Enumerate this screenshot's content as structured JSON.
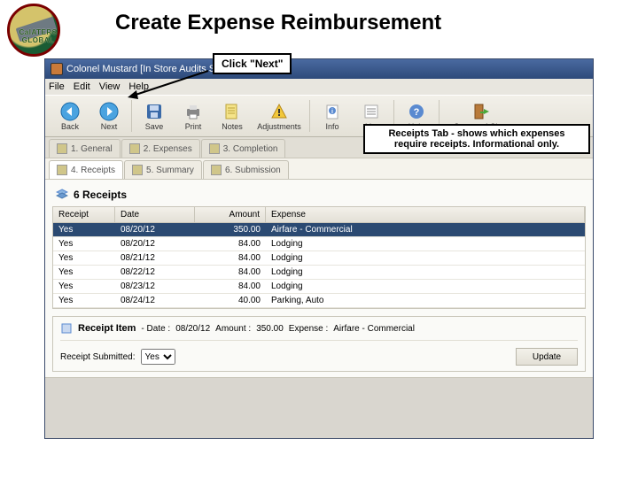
{
  "slide_title": "Create Expense Reimbursement",
  "logo_text": "CalATERS GLOBAL",
  "callouts": {
    "next": "Click  \"Next\"",
    "receipts_l1": "Receipts Tab - shows which expenses",
    "receipts_l2": "require receipts. Informational only."
  },
  "window": {
    "title": "Colonel Mustard [In Store Audits Sept. 2012]",
    "menu": [
      "File",
      "Edit",
      "View",
      "Help"
    ]
  },
  "toolbar": {
    "back": "Back",
    "next": "Next",
    "save": "Save",
    "print": "Print",
    "notes": "Notes",
    "adjustments": "Adjustments",
    "info": "Info",
    "list": "List",
    "help": "Help",
    "save_close": "Save and Close"
  },
  "tabs": {
    "t1": "1. General",
    "t2": "2. Expenses",
    "t3": "3. Completion"
  },
  "subtabs": {
    "s1": "4. Receipts",
    "s2": "5. Summary",
    "s3": "6. Submission"
  },
  "receipts_header": "6 Receipts",
  "grid": {
    "headers": {
      "receipt": "Receipt",
      "date": "Date",
      "amount": "Amount",
      "expense": "Expense"
    },
    "rows": [
      {
        "receipt": "Yes",
        "date": "08/20/12",
        "amount": "350.00",
        "expense": "Airfare - Commercial"
      },
      {
        "receipt": "Yes",
        "date": "08/20/12",
        "amount": "84.00",
        "expense": "Lodging"
      },
      {
        "receipt": "Yes",
        "date": "08/21/12",
        "amount": "84.00",
        "expense": "Lodging"
      },
      {
        "receipt": "Yes",
        "date": "08/22/12",
        "amount": "84.00",
        "expense": "Lodging"
      },
      {
        "receipt": "Yes",
        "date": "08/23/12",
        "amount": "84.00",
        "expense": "Lodging"
      },
      {
        "receipt": "Yes",
        "date": "08/24/12",
        "amount": "40.00",
        "expense": "Parking, Auto"
      }
    ]
  },
  "detail": {
    "title": "Receipt Item",
    "date_lbl": "- Date :",
    "date_val": "08/20/12",
    "amount_lbl": "Amount :",
    "amount_val": "350.00",
    "expense_lbl": "Expense :",
    "expense_val": "Airfare - Commercial",
    "submitted_lbl": "Receipt Submitted:",
    "submitted_val": "Yes",
    "update": "Update"
  }
}
